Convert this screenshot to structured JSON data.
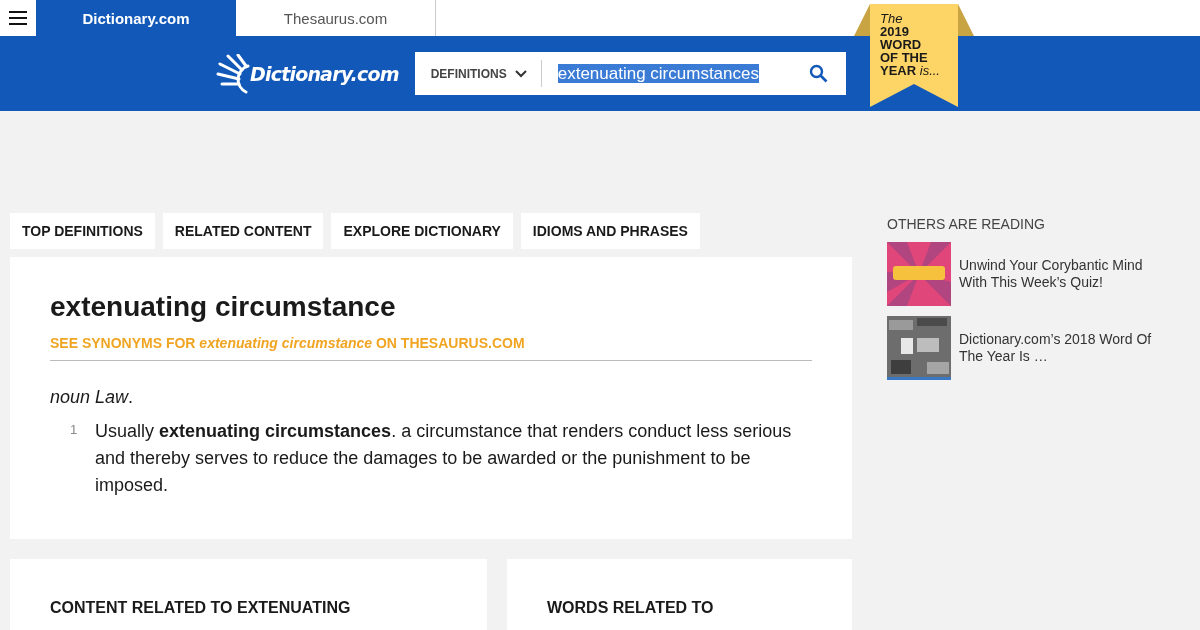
{
  "top_tabs": [
    {
      "label": "Dictionary.com",
      "selected": true
    },
    {
      "label": "Thesaurus.com",
      "selected": false
    }
  ],
  "header": {
    "logo": "Dictionary.com",
    "search_mode": "DEFINITIONS",
    "search_value": "extenuating circumstances",
    "value_selected": true
  },
  "ribbon": {
    "lead": "The",
    "year": "2019",
    "line_2": "WORD",
    "line_3": "OF THE",
    "line_4": "YEAR",
    "tail": "is..."
  },
  "section_tabs": [
    "TOP DEFINITIONS",
    "RELATED CONTENT",
    "EXPLORE DICTIONARY",
    "IDIOMS AND PHRASES"
  ],
  "entry": {
    "headword": "extenuating circumstance",
    "synonyms_link": "SEE SYNONYMS FOR *extenuating circumstance* ON THESAURUS.COM",
    "part_of_speech": "*noun Law*.",
    "definitions": [
      {
        "number": "1",
        "text": "Usually **extenuating circumstances**. a circumstance that renders conduct less serious and thereby serves to reduce the damages to be awarded or the punishment to be imposed."
      }
    ]
  },
  "related_cards": [
    {
      "title": "CONTENT RELATED TO EXTENUATING"
    },
    {
      "title": "WORDS RELATED TO"
    }
  ],
  "sidebar": {
    "heading": "OTHERS ARE READING",
    "articles": [
      {
        "title": "Unwind Your Corybantic Mind With This Week’s Quiz!",
        "kind": "quiz"
      },
      {
        "title": "Dictionary.com’s 2018 Word Of The Year Is …",
        "kind": "newsprint"
      }
    ]
  }
}
